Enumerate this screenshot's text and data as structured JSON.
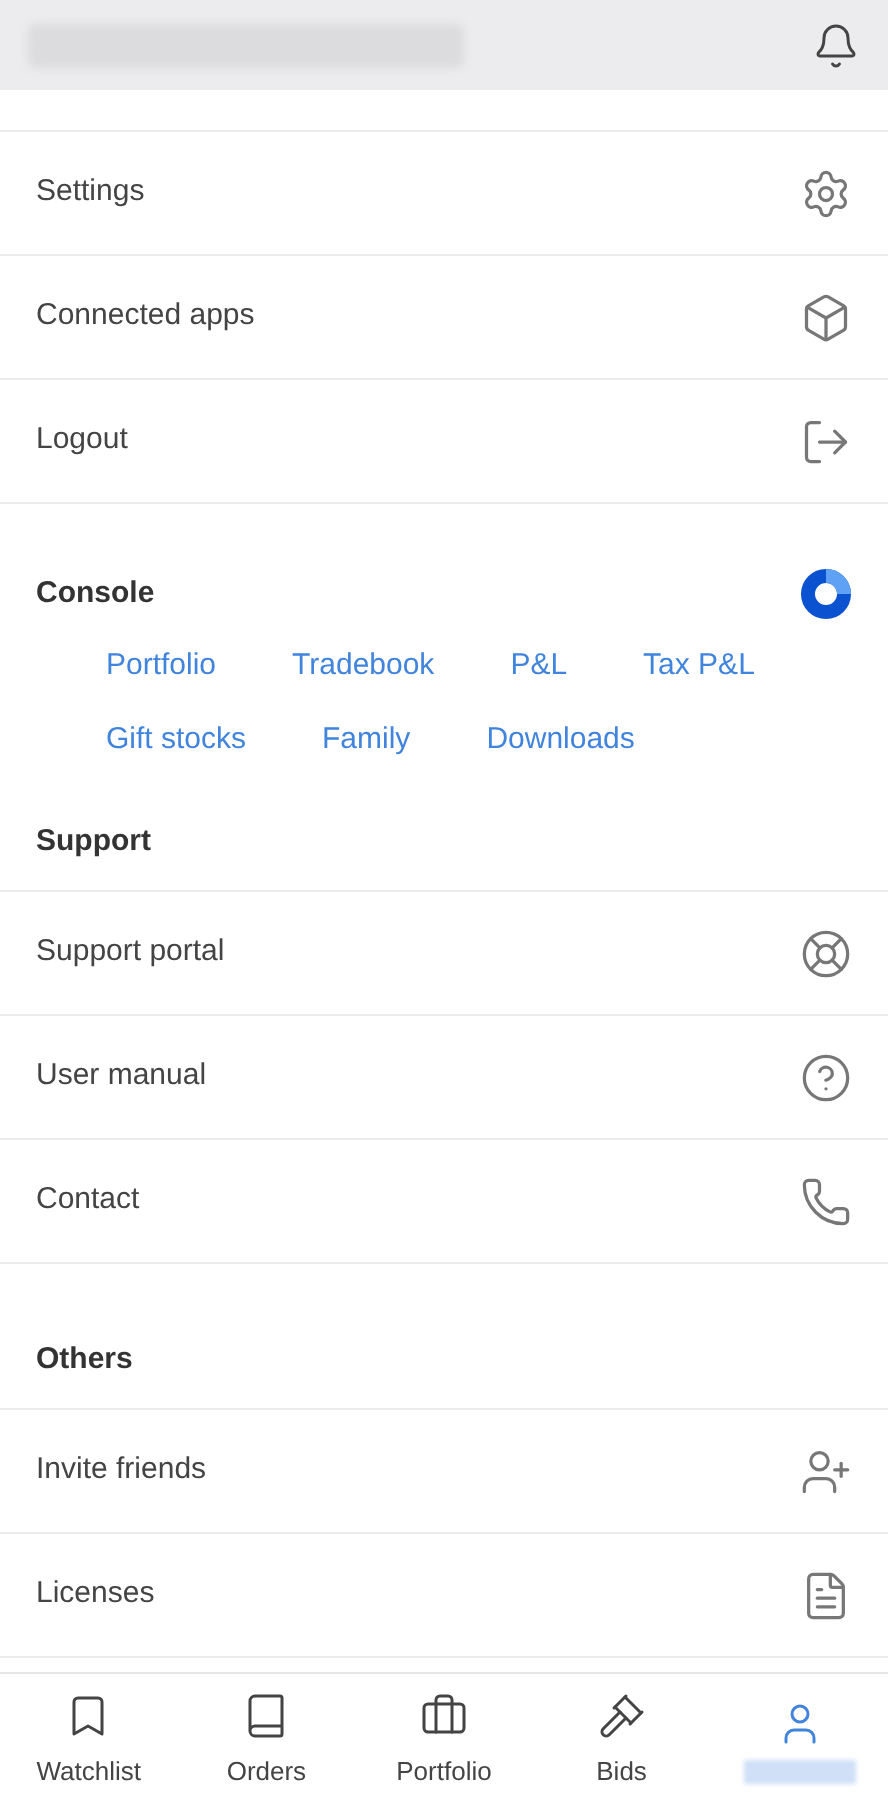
{
  "account_menu": [
    {
      "label": "Settings"
    },
    {
      "label": "Connected apps"
    },
    {
      "label": "Logout"
    }
  ],
  "console": {
    "title": "Console",
    "links": [
      {
        "label": "Portfolio"
      },
      {
        "label": "Tradebook"
      },
      {
        "label": "P&L"
      },
      {
        "label": "Tax P&L"
      },
      {
        "label": "Gift stocks"
      },
      {
        "label": "Family"
      },
      {
        "label": "Downloads"
      }
    ]
  },
  "support": {
    "title": "Support",
    "items": [
      {
        "label": "Support portal"
      },
      {
        "label": "User manual"
      },
      {
        "label": "Contact"
      }
    ]
  },
  "others": {
    "title": "Others",
    "items": [
      {
        "label": "Invite friends"
      },
      {
        "label": "Licenses"
      }
    ]
  },
  "bottom_nav": [
    {
      "label": "Watchlist",
      "selected": false
    },
    {
      "label": "Orders",
      "selected": false
    },
    {
      "label": "Portfolio",
      "selected": false
    },
    {
      "label": "Bids",
      "selected": false
    },
    {
      "selected": true
    }
  ]
}
